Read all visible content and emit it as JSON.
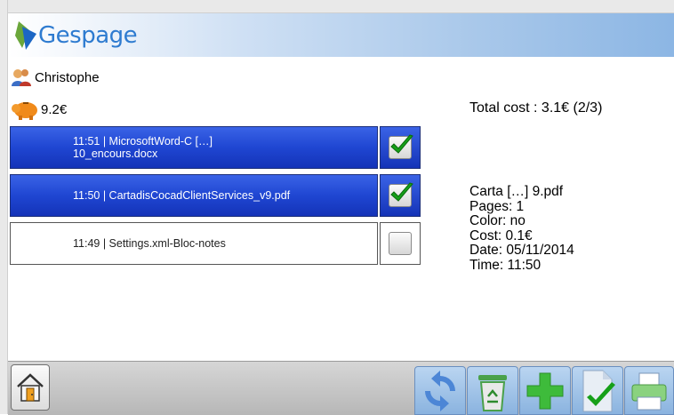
{
  "app": {
    "logo_text": "Gespage"
  },
  "user": {
    "name": "Christophe"
  },
  "balance": {
    "amount": "9.2€"
  },
  "summary": {
    "total_cost": "Total cost : 3.1€ (2/3)"
  },
  "jobs": [
    {
      "line1": "11:51 | MicrosoftWord-C […]",
      "line2": "10_encours.docx",
      "selected": true
    },
    {
      "line1": "11:50 | CartadisCocadClientServices_v9.pdf",
      "line2": "",
      "selected": true
    },
    {
      "line1": "11:49 | Settings.xml-Bloc-notes",
      "line2": "",
      "selected": false
    }
  ],
  "details": {
    "name": "Carta […] 9.pdf",
    "pages": "Pages: 1",
    "color": "Color: no",
    "cost": "Cost: 0.1€",
    "date": "Date: 05/11/2014",
    "time": "Time: 11:50"
  },
  "toolbar": {
    "buttons": [
      "home-icon",
      "refresh-icon",
      "delete-icon",
      "add-icon",
      "validate-icon",
      "print-icon"
    ]
  },
  "colors": {
    "selected_row": "#1f46d2",
    "header_gradient_end": "#8cb6e4",
    "toolbar_button": "#a4c5ea",
    "check_green": "#16a019"
  }
}
